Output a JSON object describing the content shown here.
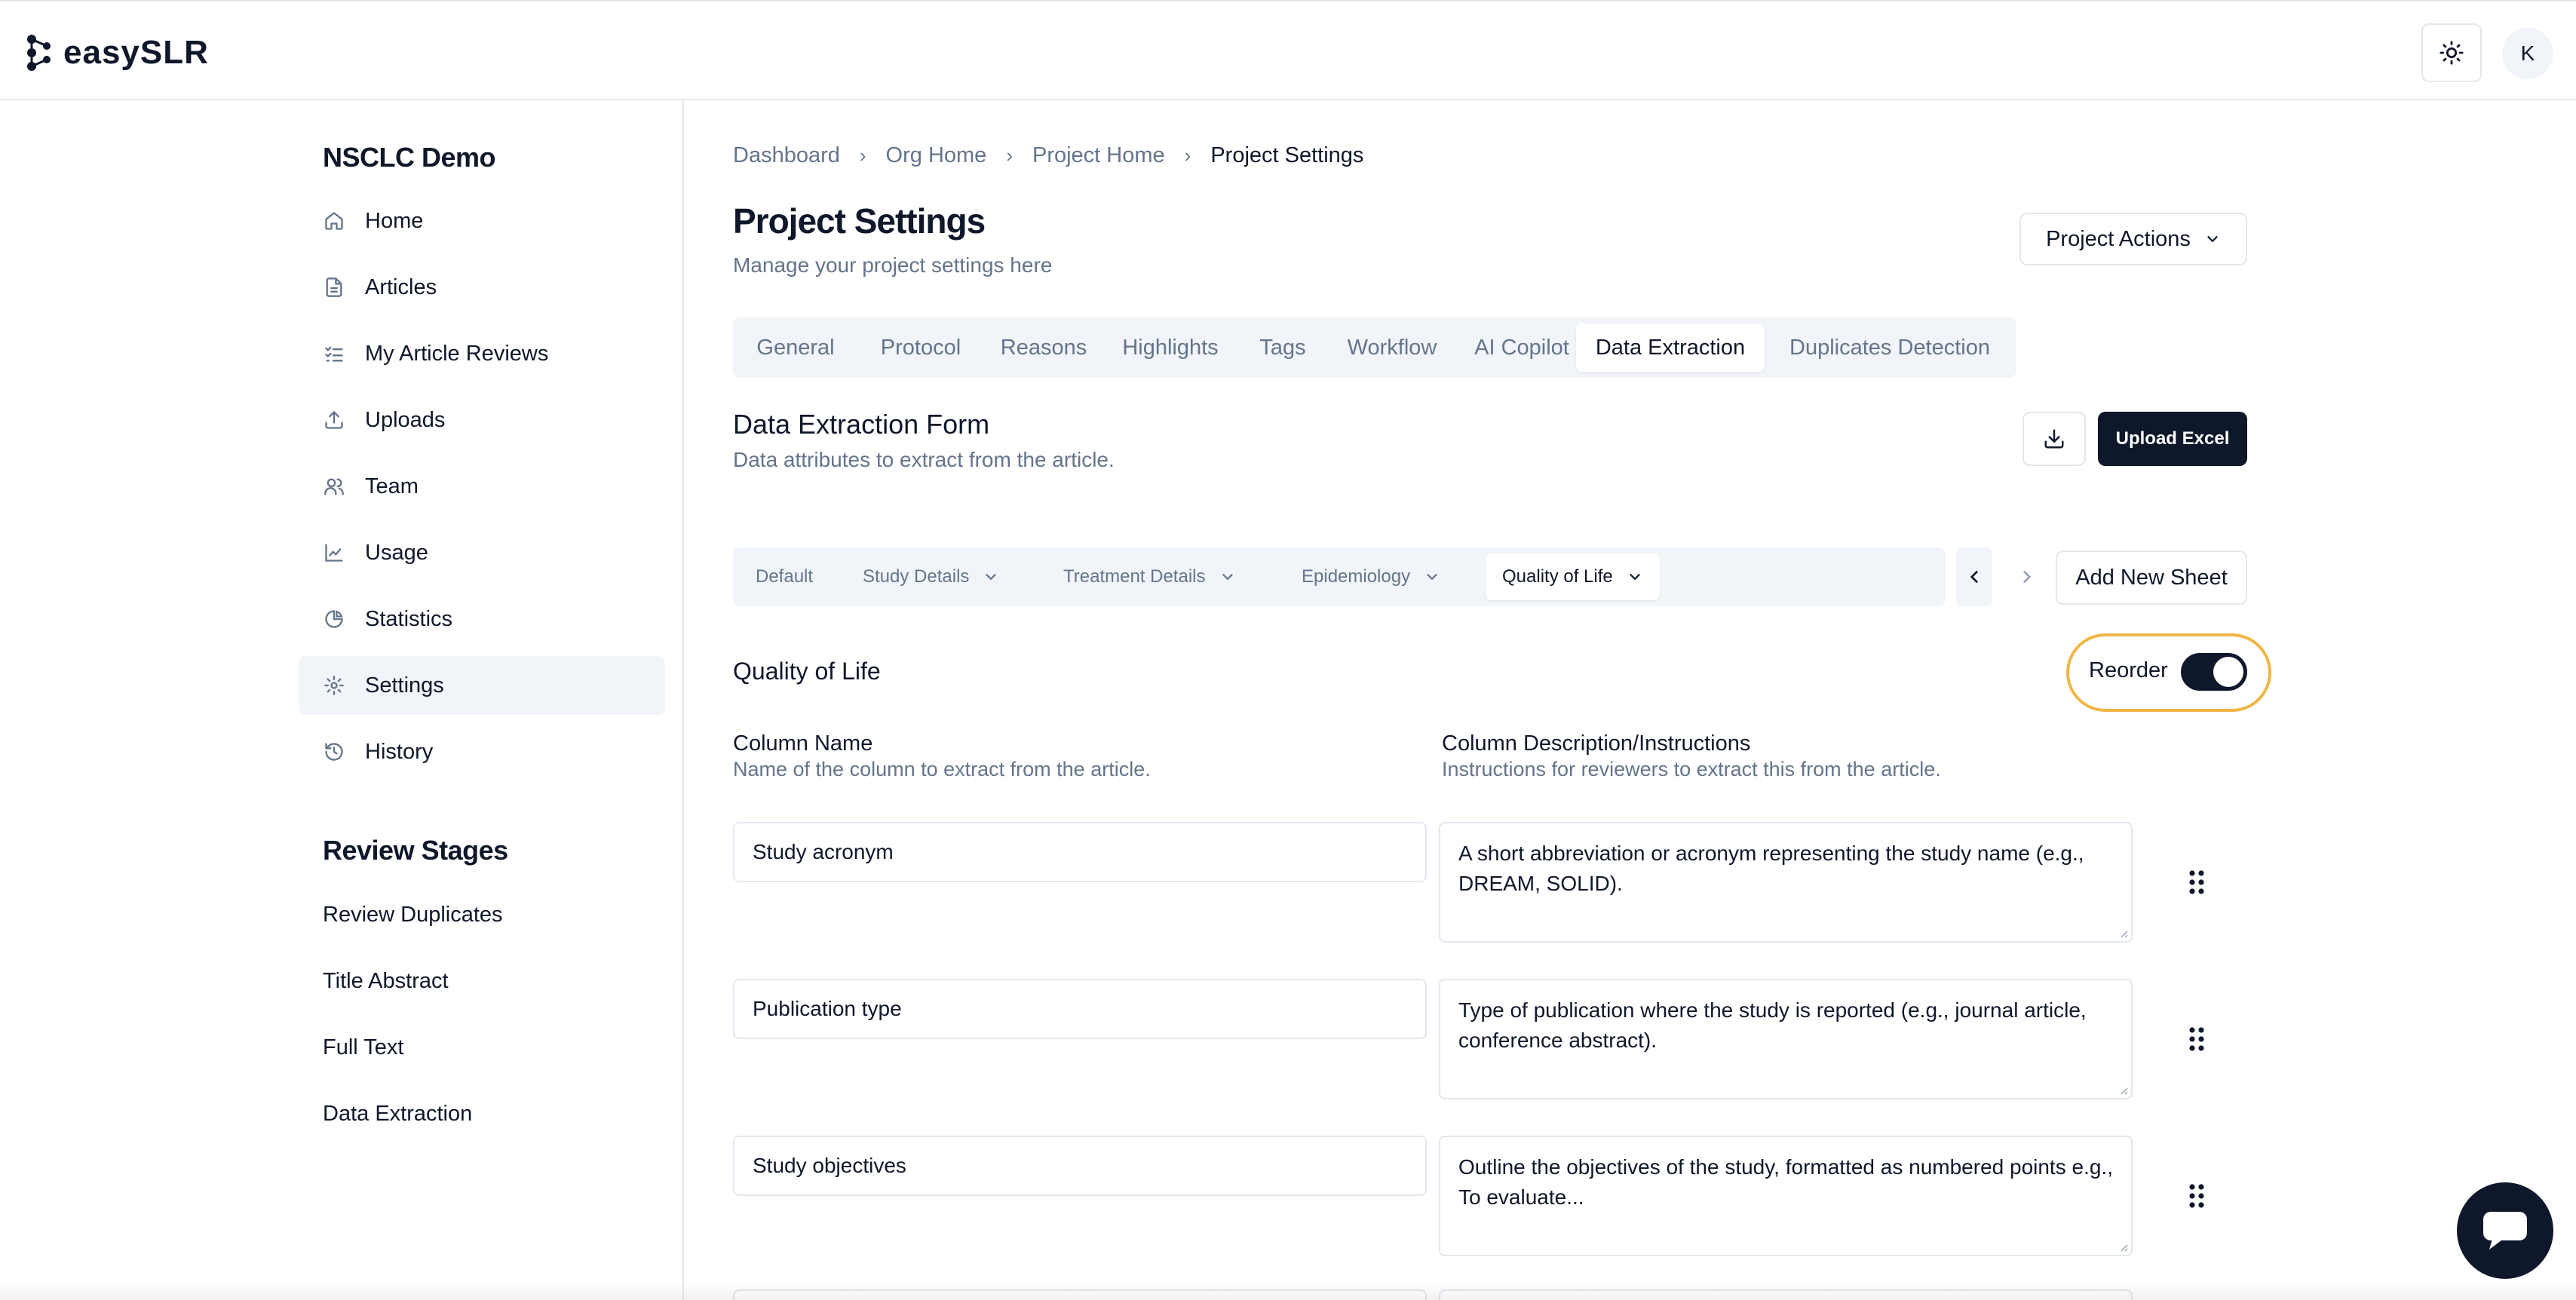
{
  "app": {
    "logo_text": "easySLR",
    "user_initial": "K"
  },
  "sidebar": {
    "project_name": "NSCLC Demo",
    "items": [
      {
        "label": "Home",
        "icon": "home-icon"
      },
      {
        "label": "Articles",
        "icon": "file-icon"
      },
      {
        "label": "My Article Reviews",
        "icon": "checklist-icon"
      },
      {
        "label": "Uploads",
        "icon": "upload-icon"
      },
      {
        "label": "Team",
        "icon": "users-icon"
      },
      {
        "label": "Usage",
        "icon": "line-chart-icon"
      },
      {
        "label": "Statistics",
        "icon": "pie-chart-icon"
      },
      {
        "label": "Settings",
        "icon": "gear-icon",
        "active": true
      },
      {
        "label": "History",
        "icon": "history-icon"
      }
    ],
    "stages_title": "Review Stages",
    "stages": [
      "Review Duplicates",
      "Title Abstract",
      "Full Text",
      "Data Extraction"
    ]
  },
  "breadcrumb": [
    "Dashboard",
    "Org Home",
    "Project Home",
    "Project Settings"
  ],
  "header": {
    "title": "Project Settings",
    "subtitle": "Manage your project settings here",
    "actions_label": "Project Actions"
  },
  "tabs": [
    "General",
    "Protocol",
    "Reasons",
    "Highlights",
    "Tags",
    "Workflow",
    "AI Copilot",
    "Data Extraction",
    "Duplicates Detection"
  ],
  "active_tab": "Data Extraction",
  "form": {
    "title": "Data Extraction Form",
    "subtitle": "Data attributes to extract from the article.",
    "upload_label": "Upload Excel"
  },
  "sheets": {
    "items": [
      "Default",
      "Study Details",
      "Treatment Details",
      "Epidemiology",
      "Quality of Life"
    ],
    "active": "Quality of Life",
    "add_label": "Add New Sheet"
  },
  "sheet_section": {
    "title": "Quality of Life",
    "reorder_label": "Reorder",
    "reorder_on": true
  },
  "columns": {
    "name_header": "Column Name",
    "name_sub": "Name of the column to extract from the article.",
    "desc_header": "Column Description/Instructions",
    "desc_sub": "Instructions for reviewers to extract this from the article."
  },
  "rows": [
    {
      "name": "Study acronym",
      "description": "A short abbreviation or acronym representing the study name (e.g., DREAM, SOLID)."
    },
    {
      "name": "Publication type",
      "description": "Type of publication where the study is reported (e.g., journal article, conference abstract)."
    },
    {
      "name": "Study objectives",
      "description": "Outline the objectives of the study, formatted as numbered points e.g., To evaluate..."
    }
  ],
  "colors": {
    "primary": "#0f172a",
    "muted": "#64748b",
    "surface": "#f1f5f9",
    "highlight_ring": "#f0b645"
  }
}
